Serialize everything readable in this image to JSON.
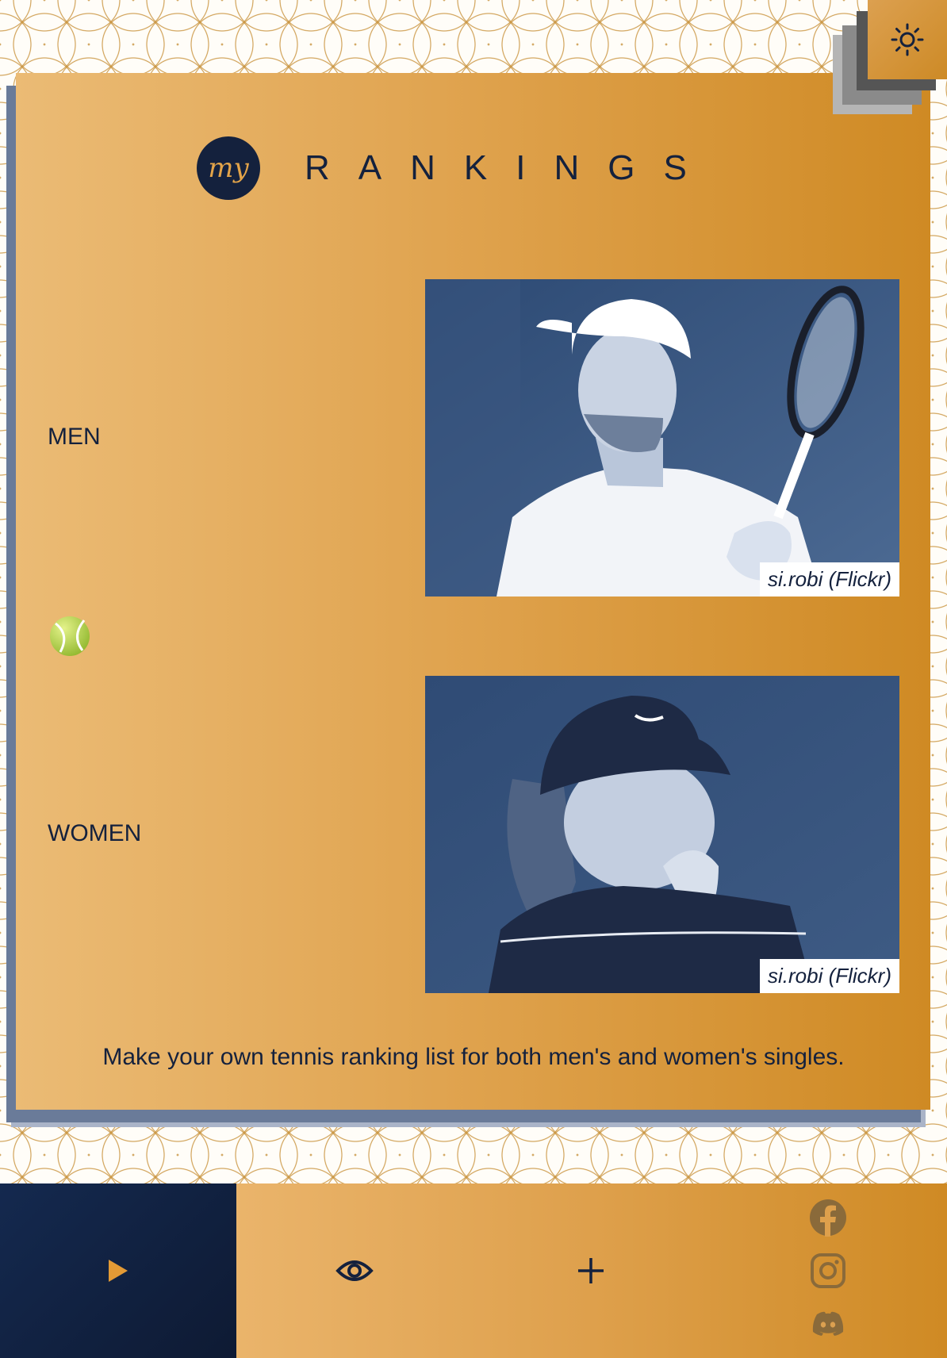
{
  "header": {
    "logo_text": "my",
    "title": "RANKINGS",
    "theme_toggle_icon": "sun-icon"
  },
  "categories": [
    {
      "label": "MEN",
      "photo_credit": "si.robi (Flickr)"
    },
    {
      "label": "WOMEN",
      "photo_credit": "si.robi (Flickr)"
    }
  ],
  "divider_icon": "tennis-ball-icon",
  "tagline": "Make your own tennis ranking list for both men's and women's singles.",
  "footer": {
    "play_icon": "play-icon",
    "view_icon": "eye-icon",
    "add_icon": "plus-icon",
    "socials": [
      "facebook-icon",
      "instagram-icon",
      "discord-icon"
    ]
  },
  "colors": {
    "navy": "#14213d",
    "gold": "#dfa24d",
    "gold_dark": "#cf8a24",
    "photo_tint": "#34507a"
  }
}
